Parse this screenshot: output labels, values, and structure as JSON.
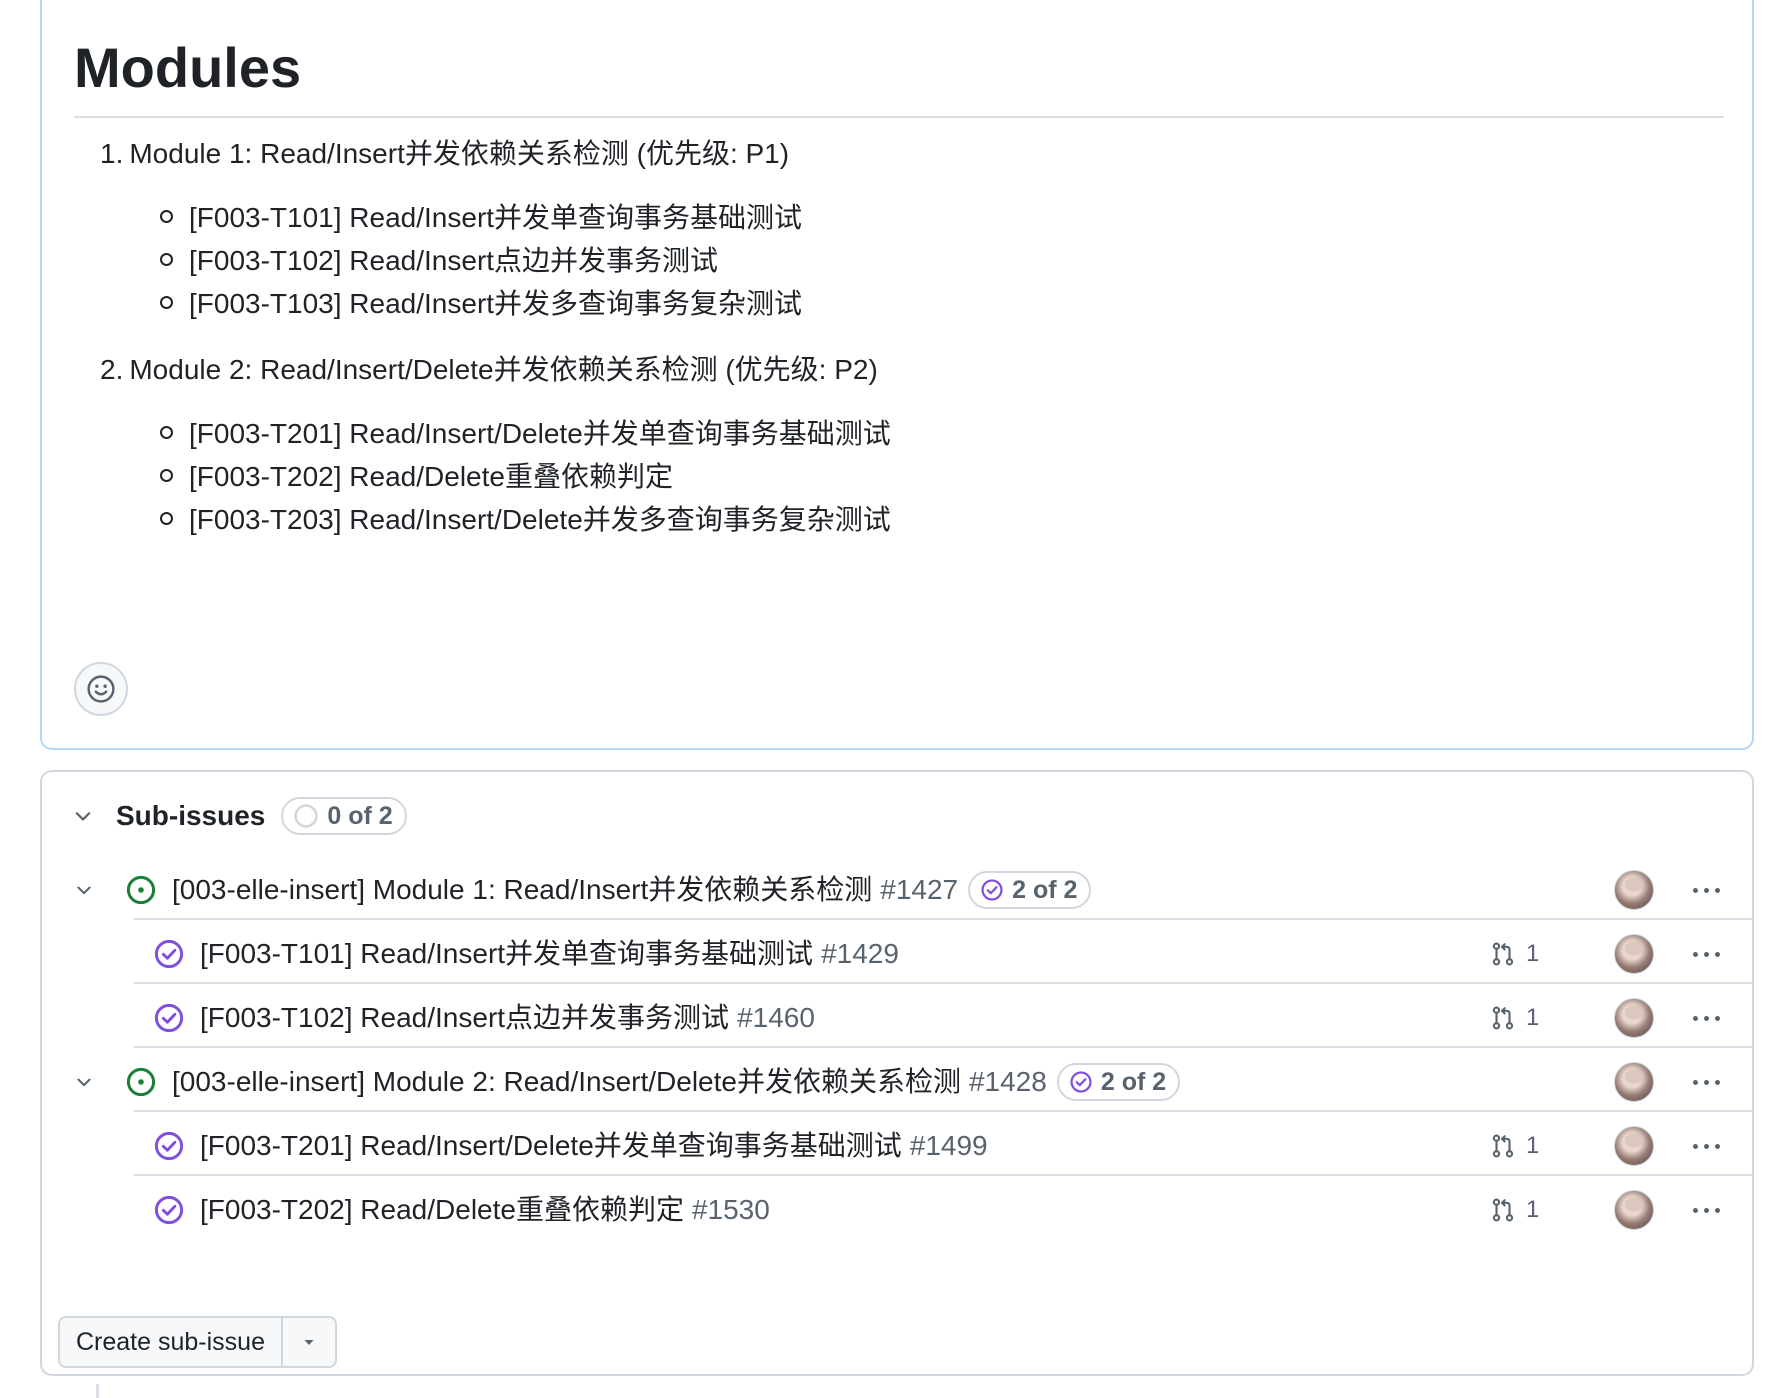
{
  "description": {
    "title": "Modules",
    "modules": [
      {
        "number": "1.",
        "heading": "Module 1: Read/Insert并发依赖关系检测 (优先级: P1)",
        "items": [
          "[F003-T101] Read/Insert并发单查询事务基础测试",
          "[F003-T102] Read/Insert点边并发事务测试",
          "[F003-T103] Read/Insert并发多查询事务复杂测试"
        ]
      },
      {
        "number": "2.",
        "heading": "Module 2: Read/Insert/Delete并发依赖关系检测 (优先级: P2)",
        "items": [
          "[F003-T201] Read/Insert/Delete并发单查询事务基础测试",
          "[F003-T202] Read/Delete重叠依赖判定",
          "[F003-T203] Read/Insert/Delete并发多查询事务复杂测试"
        ]
      }
    ],
    "reaction_icon": "smiley-icon"
  },
  "sub_issues": {
    "title": "Sub-issues",
    "progress": "0 of 2",
    "rows": [
      {
        "title": "[003-elle-insert] Module 1: Read/Insert并发依赖关系检测",
        "number": "#1427",
        "progress": "2 of 2",
        "status": "open"
      },
      {
        "title": "[F003-T101] Read/Insert并发单查询事务基础测试",
        "number": "#1429",
        "pr_count": "1",
        "status": "closed"
      },
      {
        "title": "[F003-T102] Read/Insert点边并发事务测试",
        "number": "#1460",
        "pr_count": "1",
        "status": "closed"
      },
      {
        "title": "[003-elle-insert] Module 2: Read/Insert/Delete并发依赖关系检测",
        "number": "#1428",
        "progress": "2 of 2",
        "status": "open"
      },
      {
        "title": "[F003-T201] Read/Insert/Delete并发单查询事务基础测试",
        "number": "#1499",
        "pr_count": "1",
        "status": "closed"
      },
      {
        "title": "[F003-T202] Read/Delete重叠依赖判定",
        "number": "#1530",
        "pr_count": "1",
        "status": "closed"
      }
    ],
    "create_label": "Create sub-issue"
  },
  "colors": {
    "open": "#1a7f37",
    "closed": "#8250df",
    "muted": "#59636e",
    "border": "#d0d7de",
    "focus_border": "#b6d7f6"
  }
}
